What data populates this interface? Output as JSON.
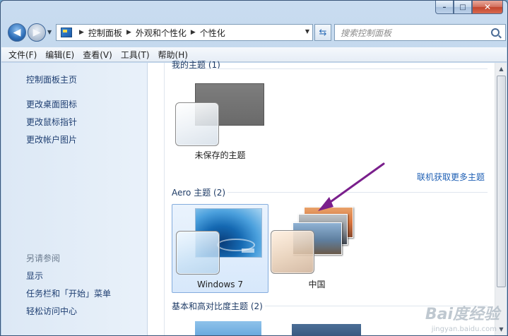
{
  "window": {
    "caption_buttons": [
      "minimize",
      "maximize",
      "close"
    ]
  },
  "navigation": {
    "breadcrumbs": [
      "控制面板",
      "外观和个性化",
      "个性化"
    ],
    "search_placeholder": "搜索控制面板"
  },
  "menubar": {
    "items": [
      "文件(F)",
      "编辑(E)",
      "查看(V)",
      "工具(T)",
      "帮助(H)"
    ]
  },
  "sidebar": {
    "links": [
      "控制面板主页",
      "更改桌面图标",
      "更改鼠标指针",
      "更改帐户图片"
    ],
    "see_also_heading": "另请参阅",
    "see_also_links": [
      "显示",
      "任务栏和「开始」菜单",
      "轻松访问中心"
    ]
  },
  "main": {
    "my_themes_label": "我的主题 (1)",
    "unsaved_theme_label": "未保存的主题",
    "online_link": "联机获取更多主题",
    "aero_label": "Aero 主题 (2)",
    "aero_themes": [
      "Windows 7",
      "中国"
    ],
    "basic_label": "基本和高对比度主题 (2)"
  },
  "watermark": {
    "text": "Bai度经验",
    "sub": "jingyan.baidu.com"
  },
  "colors": {
    "link": "#1f3f72",
    "accent_link": "#1e5fb4",
    "annotation_arrow": "#7a1f8c",
    "selection_border": "#84acdd"
  }
}
